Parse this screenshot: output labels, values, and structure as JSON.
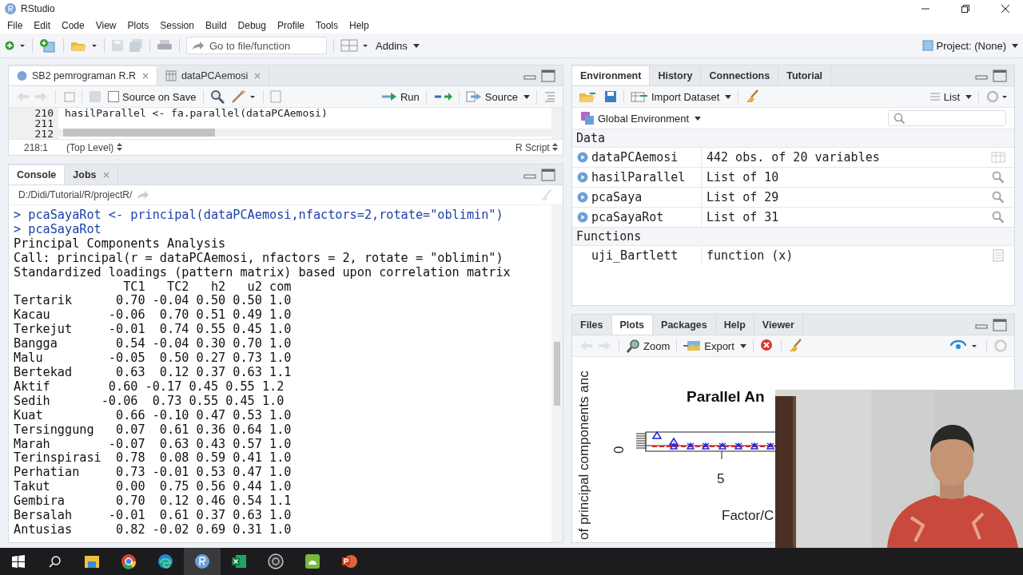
{
  "window": {
    "title": "RStudio"
  },
  "menu": [
    "File",
    "Edit",
    "Code",
    "View",
    "Plots",
    "Session",
    "Build",
    "Debug",
    "Profile",
    "Tools",
    "Help"
  ],
  "toolbar": {
    "goto_placeholder": "Go to file/function",
    "addins": "Addins",
    "project": "Project: (None)"
  },
  "editor": {
    "tabs": [
      {
        "label": "SB2 pemrograman R.R",
        "selected": true,
        "kind": "script"
      },
      {
        "label": "dataPCAemosi",
        "selected": false,
        "kind": "data"
      }
    ],
    "source_on_save": {
      "label": "Source on Save",
      "checked": false
    },
    "run": "Run",
    "source": "Source",
    "lines": [
      {
        "number": "210",
        "code": "hasilParallel <- fa.parallel(dataPCAemosi)"
      },
      {
        "number": "211"
      },
      {
        "number": "212"
      }
    ],
    "status": {
      "position": "218:1",
      "scope": "(Top Level)",
      "type": "R Script"
    }
  },
  "console": {
    "tabs": [
      {
        "label": "Console",
        "selected": true,
        "closable": false
      },
      {
        "label": "Jobs",
        "selected": false,
        "closable": true
      }
    ],
    "path": "D:/Didi/Tutorial/R/projectR/",
    "lines": [
      {
        "kind": "input",
        "text": "> pcaSayaRot <- principal(dataPCAemosi,nfactors=2,rotate=\"oblimin\")"
      },
      {
        "kind": "input",
        "text": "> pcaSayaRot"
      },
      {
        "kind": "output",
        "text": "Principal Components Analysis"
      },
      {
        "kind": "output",
        "text": "Call: principal(r = dataPCAemosi, nfactors = 2, rotate = \"oblimin\")"
      },
      {
        "kind": "output",
        "text": "Standardized loadings (pattern matrix) based upon correlation matrix"
      },
      {
        "kind": "output",
        "text": "               TC1   TC2   h2   u2 com"
      },
      {
        "kind": "output",
        "text": "Tertarik      0.70 -0.04 0.50 0.50 1.0"
      },
      {
        "kind": "output",
        "text": "Kacau        -0.06  0.70 0.51 0.49 1.0"
      },
      {
        "kind": "output",
        "text": "Terkejut     -0.01  0.74 0.55 0.45 1.0"
      },
      {
        "kind": "output",
        "text": "Bangga        0.54 -0.04 0.30 0.70 1.0"
      },
      {
        "kind": "output",
        "text": "Malu         -0.05  0.50 0.27 0.73 1.0"
      },
      {
        "kind": "output",
        "text": "Bertekad      0.63  0.12 0.37 0.63 1.1"
      },
      {
        "kind": "output",
        "text": "Aktif        0.60 -0.17 0.45 0.55 1.2"
      },
      {
        "kind": "output",
        "text": "Sedih       -0.06  0.73 0.55 0.45 1.0"
      },
      {
        "kind": "output",
        "text": "Kuat          0.66 -0.10 0.47 0.53 1.0"
      },
      {
        "kind": "output",
        "text": "Tersinggung   0.07  0.61 0.36 0.64 1.0"
      },
      {
        "kind": "output",
        "text": "Marah        -0.07  0.63 0.43 0.57 1.0"
      },
      {
        "kind": "output",
        "text": "Terinspirasi  0.78  0.08 0.59 0.41 1.0"
      },
      {
        "kind": "output",
        "text": "Perhatian     0.73 -0.01 0.53 0.47 1.0"
      },
      {
        "kind": "output",
        "text": "Takut         0.00  0.75 0.56 0.44 1.0"
      },
      {
        "kind": "output",
        "text": "Gembira       0.70  0.12 0.46 0.54 1.1"
      },
      {
        "kind": "output",
        "text": "Bersalah     -0.01  0.61 0.37 0.63 1.0"
      },
      {
        "kind": "output",
        "text": "Antusias      0.82 -0.02 0.69 0.31 1.0"
      }
    ]
  },
  "environment": {
    "tabs": [
      {
        "label": "Environment",
        "selected": true
      },
      {
        "label": "History",
        "selected": false
      },
      {
        "label": "Connections",
        "selected": false
      },
      {
        "label": "Tutorial",
        "selected": false
      }
    ],
    "import": "Import Dataset",
    "view": "List",
    "scope": "Global Environment",
    "sections": [
      {
        "title": "Data",
        "items": [
          {
            "name": "dataPCAemosi",
            "value": "442 obs. of 20 variables",
            "kind": "data"
          },
          {
            "name": "hasilParallel",
            "value": "List of 10",
            "kind": "list"
          },
          {
            "name": "pcaSaya",
            "value": "List of 29",
            "kind": "list"
          },
          {
            "name": "pcaSayaRot",
            "value": "List of 31",
            "kind": "list"
          }
        ]
      },
      {
        "title": "Functions",
        "items": [
          {
            "name": "uji_Bartlett",
            "value": "function (x)",
            "kind": "function"
          }
        ]
      }
    ]
  },
  "plots": {
    "tabs": [
      {
        "label": "Files",
        "selected": false
      },
      {
        "label": "Plots",
        "selected": true
      },
      {
        "label": "Packages",
        "selected": false
      },
      {
        "label": "Help",
        "selected": false
      },
      {
        "label": "Viewer",
        "selected": false
      }
    ],
    "zoom": "Zoom",
    "export": "Export",
    "plot": {
      "title": "Parallel An",
      "ylabel": "of principal components anc",
      "xlabel": "Factor/C",
      "xtick": "5",
      "ytick": "0"
    }
  },
  "taskbar": [
    {
      "selected": false
    },
    {
      "selected": false
    },
    {
      "selected": false
    },
    {
      "selected": false
    },
    {
      "selected": false
    },
    {
      "selected": true
    },
    {
      "selected": false
    },
    {
      "selected": false
    },
    {
      "selected": false
    },
    {
      "selected": false
    }
  ]
}
